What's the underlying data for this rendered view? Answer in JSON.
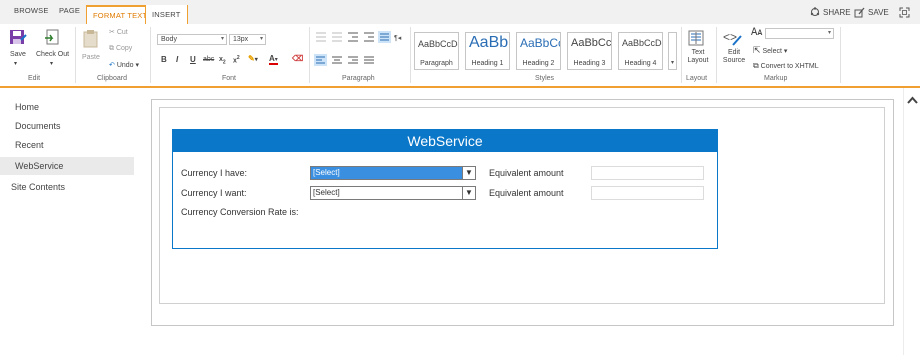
{
  "tabs": [
    {
      "label": "BROWSE"
    },
    {
      "label": "PAGE"
    },
    {
      "label": "FORMAT TEXT"
    },
    {
      "label": "INSERT"
    }
  ],
  "top_actions": {
    "share": "SHARE",
    "save": "SAVE"
  },
  "ribbon": {
    "edit": {
      "save": "Save",
      "check_out": "Check Out",
      "group": "Edit"
    },
    "clipboard": {
      "paste": "Paste",
      "cut": "Cut",
      "copy": "Copy",
      "undo": "Undo",
      "group": "Clipboard"
    },
    "font": {
      "family": "Body",
      "size": "13px",
      "group": "Font"
    },
    "paragraph": {
      "group": "Paragraph"
    },
    "styles": {
      "group": "Styles",
      "items": [
        {
          "sample": "AaBbCcDdE",
          "name": "Paragraph"
        },
        {
          "sample": "AaBb",
          "name": "Heading 1"
        },
        {
          "sample": "AaBbCc",
          "name": "Heading 2"
        },
        {
          "sample": "AaBbCcDd",
          "name": "Heading 3"
        },
        {
          "sample": "AaBbCcDdE",
          "name": "Heading 4"
        }
      ]
    },
    "layout": {
      "text_layout": "Text Layout",
      "group": "Layout"
    },
    "markup": {
      "edit_source": "Edit Source",
      "select": "Select",
      "convert": "Convert to XHTML",
      "group": "Markup"
    }
  },
  "nav": {
    "items": [
      "Home",
      "Documents",
      "Recent"
    ],
    "selected": "WebService",
    "site_contents": "Site Contents"
  },
  "webservice": {
    "title": "WebService",
    "currency_have_label": "Currency I have:",
    "currency_want_label": "Currency I want:",
    "rate_label": "Currency Conversion Rate is:",
    "select_have": "[Select]",
    "select_want": "[Select]",
    "equiv1": "Equivalent amount",
    "equiv2": "Equivalent amount"
  }
}
